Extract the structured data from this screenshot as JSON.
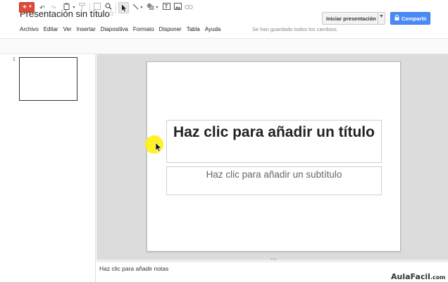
{
  "document": {
    "title": "Presentación sin título"
  },
  "menu": {
    "items": [
      "Archivo",
      "Editar",
      "Ver",
      "Insertar",
      "Diapositiva",
      "Formato",
      "Disponer",
      "Tabla",
      "Ayuda"
    ],
    "save_status": "Se han guardado todos los cambios."
  },
  "header": {
    "present_label": "Iniciar presentación",
    "share_label": "Compartir"
  },
  "toolbar": {
    "icons": [
      "new-slide-icon",
      "undo-icon",
      "redo-icon",
      "paste-icon",
      "paint-format-icon",
      "fit-icon",
      "zoom-icon",
      "select-icon",
      "line-icon",
      "shape-icon",
      "textbox-icon",
      "image-icon",
      "link-icon"
    ],
    "new_slide_glyph": "+"
  },
  "filmstrip": {
    "slide_number": "1"
  },
  "slide": {
    "title_placeholder": "Haz clic para añadir un título",
    "subtitle_placeholder": "Haz clic para añadir un subtítulo"
  },
  "notes": {
    "placeholder": "Haz clic para añadir notas"
  },
  "watermark": {
    "text": "AulaFacil",
    "suffix": ".com"
  },
  "colors": {
    "share": "#4a8af4",
    "new_slide": "#dd4b39",
    "canvas_bg": "#dcdcdc",
    "highlight": "#fff000"
  }
}
